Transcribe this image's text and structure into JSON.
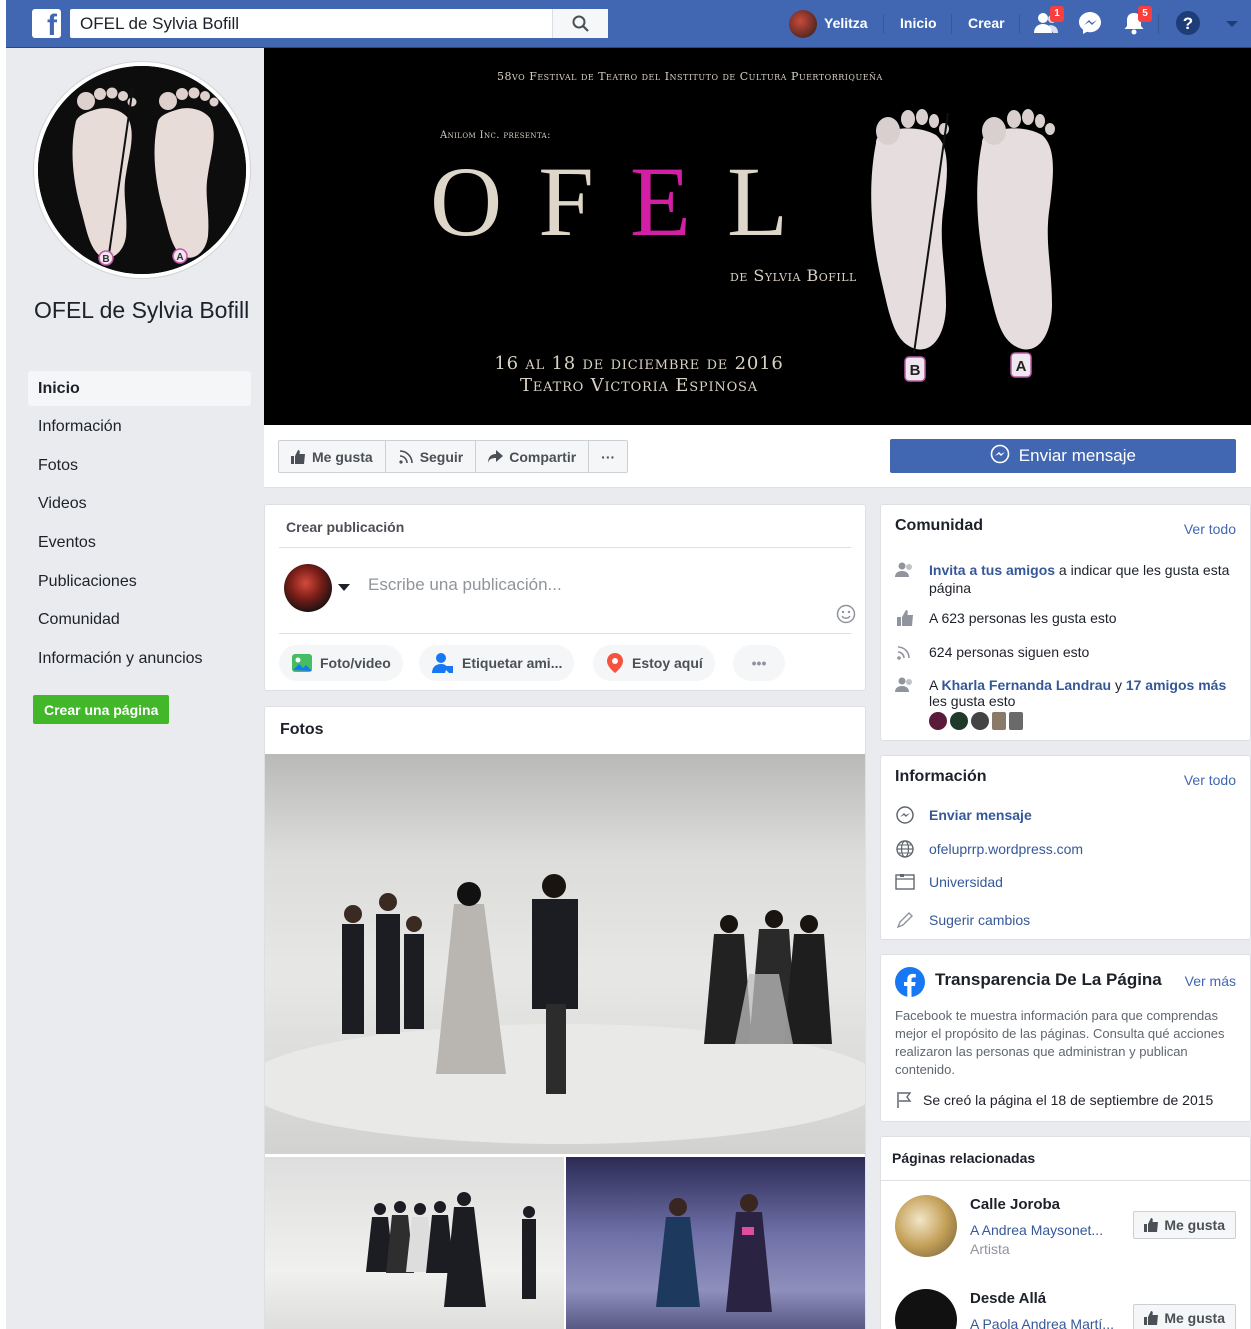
{
  "topbar": {
    "search_value": "OFEL de Sylvia Bofill",
    "user_name": "Yelitza",
    "home_label": "Inicio",
    "create_label": "Crear",
    "friend_requests_count": "1",
    "notifications_count": "5"
  },
  "page": {
    "name": "OFEL de Sylvia Bofill"
  },
  "nav": {
    "items": [
      "Inicio",
      "Información",
      "Fotos",
      "Videos",
      "Eventos",
      "Publicaciones",
      "Comunidad",
      "Información y anuncios"
    ],
    "create_page_label": "Crear una página"
  },
  "cover": {
    "line1": "58vo Festival de Teatro del Instituto de Cultura Puertorriqueña",
    "line2": "Anilom Inc. presenta:",
    "title_part1": "OF",
    "title_part2": "E",
    "title_part3": "L",
    "subtitle": "de Sylvia Bofill",
    "dates": "16 al 18 de diciembre de 2016",
    "venue": "Teatro Victoria Espinosa",
    "foot_b": "B",
    "foot_a": "A"
  },
  "actions": {
    "like_label": "Me gusta",
    "follow_label": "Seguir",
    "share_label": "Compartir",
    "more_label": "···",
    "message_label": "Enviar mensaje"
  },
  "create_post": {
    "title": "Crear publicación",
    "placeholder": "Escribe una publicación...",
    "photo_video": "Foto/video",
    "tag_friends": "Etiquetar ami...",
    "check_in": "Estoy aquí",
    "more": "•••"
  },
  "photos": {
    "title": "Fotos"
  },
  "community": {
    "title": "Comunidad",
    "see_all": "Ver todo",
    "invite_link": "Invita a tus amigos",
    "invite_rest": " a indicar que les gusta esta página",
    "likes_text": "A 623 personas les gusta esto",
    "follows_text": "624 personas siguen esto",
    "friends_prefix": "A ",
    "friend_name": "Kharla Fernanda Landrau",
    "friends_mid": " y ",
    "friends_more": "17 amigos más",
    "friends_suffix": "les gusta esto"
  },
  "info": {
    "title": "Información",
    "see_all": "Ver todo",
    "send_message": "Enviar mensaje",
    "website": "ofeluprrp.wordpress.com",
    "category": "Universidad",
    "suggest_edits": "Sugerir cambios"
  },
  "transparency": {
    "title": "Transparencia De La Página",
    "see_more": "Ver más",
    "description": "Facebook te muestra información para que comprendas mejor el propósito de las páginas. Consulta qué acciones realizaron las personas que administran y publican contenido.",
    "created": "Se creó la página el 18 de septiembre de 2015"
  },
  "related": {
    "title": "Páginas relacionadas",
    "items": [
      {
        "name": "Calle Joroba",
        "liked_by": "A Andrea Maysonet...",
        "category": "Artista",
        "button": "Me gusta"
      },
      {
        "name": "Desde Allá",
        "liked_by": "A Paola Andrea Martí...",
        "category": "",
        "button": "Me gusta"
      }
    ]
  },
  "colors": {
    "brand_blue": "#4267b2",
    "link_blue": "#365899",
    "green": "#42b72a",
    "background": "#e9ebee",
    "title_accent": "#d21fa3"
  }
}
